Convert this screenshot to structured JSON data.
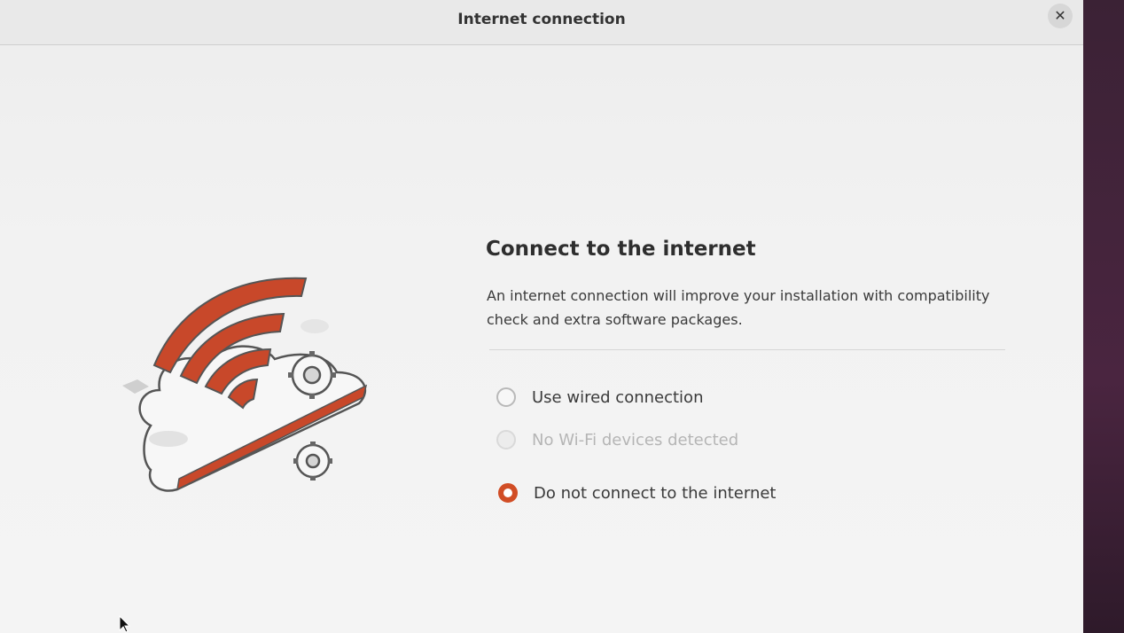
{
  "window": {
    "title": "Internet connection",
    "close_icon": "close-icon",
    "close_glyph": "✕"
  },
  "content": {
    "heading": "Connect to the internet",
    "description": "An internet connection will improve your installation with compatibility check and extra software packages.",
    "illustration_icon": "wifi-cloud-gears-icon"
  },
  "options": [
    {
      "label": "Use wired connection",
      "selected": false,
      "enabled": true
    },
    {
      "label": "No Wi-Fi devices detected",
      "selected": false,
      "enabled": false
    },
    {
      "label": "Do not connect to the internet",
      "selected": true,
      "enabled": true
    }
  ],
  "colors": {
    "accent": "#d14d25",
    "background": "#f2f2f2",
    "desktop": "#3b2235"
  }
}
